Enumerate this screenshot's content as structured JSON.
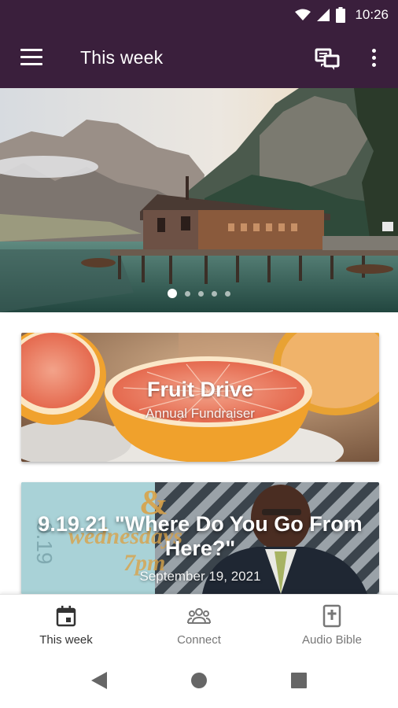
{
  "status_bar": {
    "time": "10:26",
    "icons": [
      "wifi-icon",
      "signal-icon",
      "battery-icon"
    ]
  },
  "app_bar": {
    "title": "This week",
    "icons": [
      "menu-icon",
      "chat-icon",
      "more-vert-icon"
    ]
  },
  "hero": {
    "description_icon": "landscape-image",
    "slide_count": 5,
    "active_slide": 1
  },
  "cards": [
    {
      "title": "Fruit Drive",
      "subtitle": "Annual Fundraiser"
    },
    {
      "title": "9.19.21 \"Where Do You Go From Here?\"",
      "subtitle": "September 19, 2021"
    }
  ],
  "bottom_nav": {
    "items": [
      {
        "label": "This week",
        "icon": "calendar-icon",
        "active": true
      },
      {
        "label": "Connect",
        "icon": "group-icon",
        "active": false
      },
      {
        "label": "Audio Bible",
        "icon": "bible-icon",
        "active": false
      }
    ]
  },
  "system_nav": {
    "icons": [
      "back-icon",
      "home-icon",
      "recents-icon"
    ]
  },
  "colors": {
    "app_bar_bg": "#3a1f3c",
    "nav_active": "#333333",
    "nav_inactive": "#777777"
  }
}
